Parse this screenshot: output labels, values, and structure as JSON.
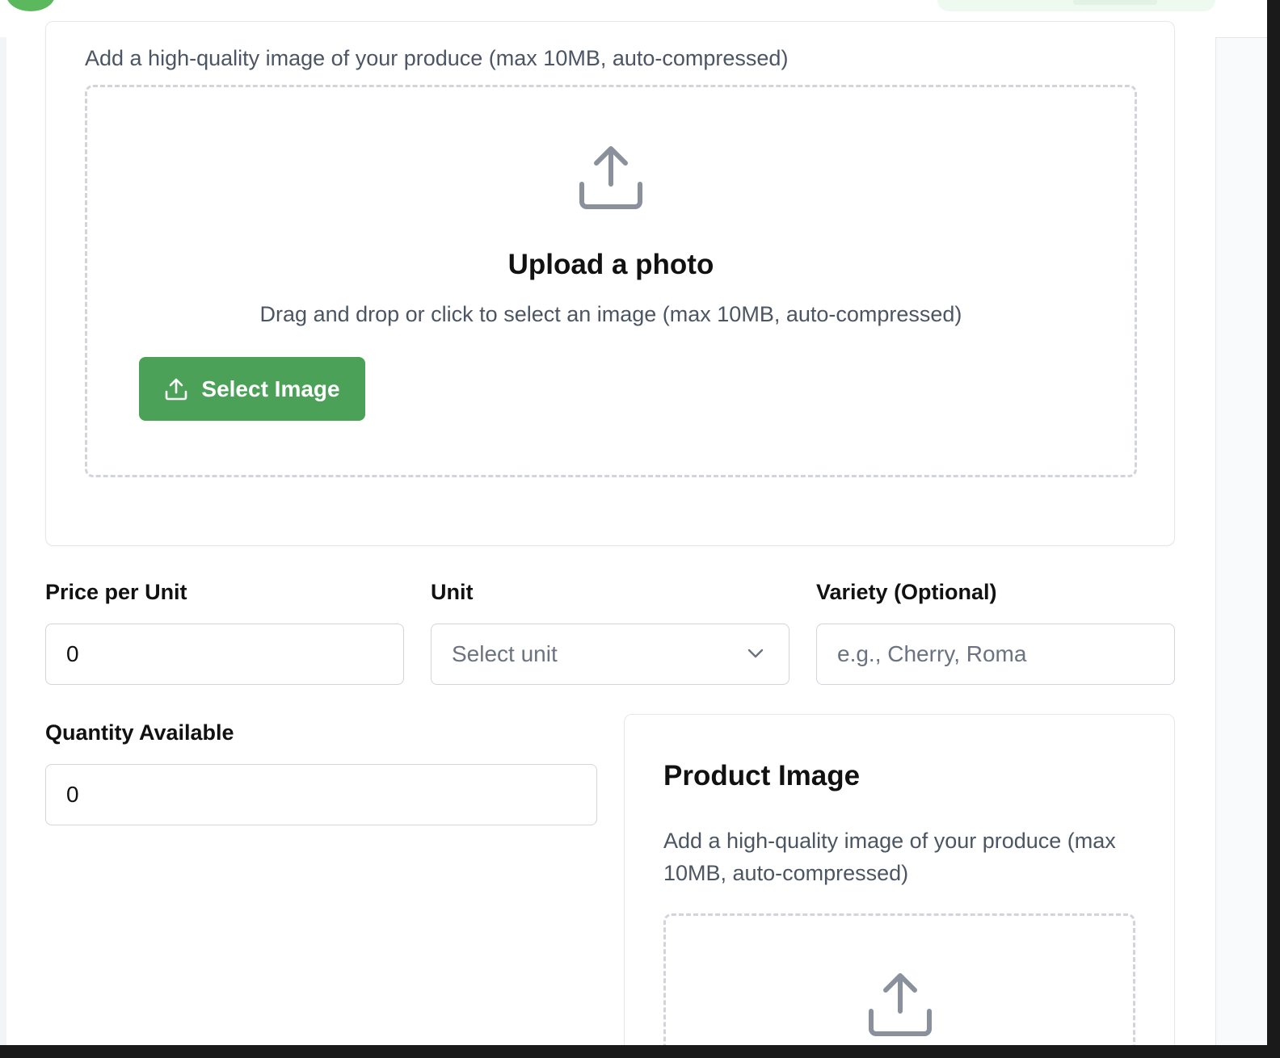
{
  "colors": {
    "primary": "#4ba157",
    "text": "#111111",
    "muted": "#4b5563",
    "border": "#d1d5db"
  },
  "upload_card": {
    "description": "Add a high-quality image of your produce (max 10MB, auto-compressed)",
    "dropzone": {
      "icon": "upload-icon",
      "title": "Upload a photo",
      "subtitle": "Drag and drop or click to select an image (max 10MB, auto-compressed)",
      "button_label": "Select Image",
      "button_icon": "upload-icon"
    }
  },
  "form": {
    "price": {
      "label": "Price per Unit",
      "value": "0"
    },
    "unit": {
      "label": "Unit",
      "placeholder": "Select unit",
      "icon": "chevron-down-icon"
    },
    "variety": {
      "label": "Variety (Optional)",
      "placeholder": "e.g., Cherry, Roma"
    },
    "quantity": {
      "label": "Quantity Available",
      "value": "0"
    }
  },
  "product_image_card": {
    "title": "Product Image",
    "description": "Add a high-quality image of your produce (max 10MB, auto-compressed)",
    "icon": "upload-icon"
  }
}
